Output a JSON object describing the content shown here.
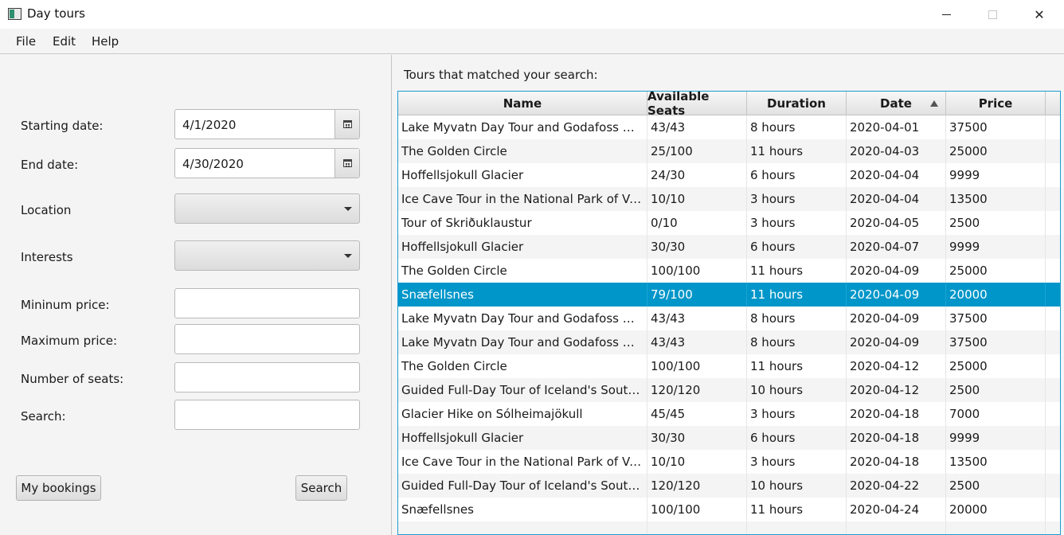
{
  "window": {
    "title": "Day tours",
    "minimize": "",
    "maximize": "",
    "close": "✕"
  },
  "menu": [
    "File",
    "Edit",
    "Help"
  ],
  "form": {
    "starting_date_label": "Starting date:",
    "starting_date_value": "4/1/2020",
    "end_date_label": "End date:",
    "end_date_value": "4/30/2020",
    "location_label": "Location",
    "location_value": "",
    "interests_label": "Interests",
    "interests_value": "",
    "min_price_label": "Mininum price:",
    "min_price_value": "",
    "max_price_label": "Maximum price:",
    "max_price_value": "",
    "seats_label": "Number of seats:",
    "seats_value": "",
    "search_label": "Search:",
    "search_value": "",
    "my_bookings_button": "My bookings",
    "search_button": "Search"
  },
  "results": {
    "label": "Tours that matched your search:",
    "columns": [
      "Name",
      "Available Seats",
      "Duration",
      "Date",
      "Price"
    ],
    "sorted_column": "Date",
    "sort_direction": "ascending",
    "selected_row": 7,
    "rows": [
      [
        "Lake Myvatn Day Tour and Godafoss Waterf...",
        "43/43",
        "8 hours",
        "2020-04-01",
        "37500"
      ],
      [
        "The Golden Circle",
        "25/100",
        "11 hours",
        "2020-04-03",
        "25000"
      ],
      [
        "Hoffellsjokull Glacier",
        "24/30",
        "6 hours",
        "2020-04-04",
        "9999"
      ],
      [
        "Ice Cave Tour in the National Park of Vatnaj...",
        "10/10",
        "3 hours",
        "2020-04-04",
        "13500"
      ],
      [
        "Tour of Skriðuklaustur",
        "0/10",
        "3 hours",
        "2020-04-05",
        "2500"
      ],
      [
        "Hoffellsjokull Glacier",
        "30/30",
        "6 hours",
        "2020-04-07",
        "9999"
      ],
      [
        "The Golden Circle",
        "100/100",
        "11 hours",
        "2020-04-09",
        "25000"
      ],
      [
        "Snæfellsnes",
        "79/100",
        "11 hours",
        "2020-04-09",
        "20000"
      ],
      [
        "Lake Myvatn Day Tour and Godafoss Waterf...",
        "43/43",
        "8 hours",
        "2020-04-09",
        "37500"
      ],
      [
        "Lake Myvatn Day Tour and Godafoss Waterf...",
        "43/43",
        "8 hours",
        "2020-04-09",
        "37500"
      ],
      [
        "The Golden Circle",
        "100/100",
        "11 hours",
        "2020-04-12",
        "25000"
      ],
      [
        "Guided Full-Day Tour of Iceland's South Coast",
        "120/120",
        "10 hours",
        "2020-04-12",
        "2500"
      ],
      [
        "Glacier Hike on Sólheimajökull",
        "45/45",
        "3 hours",
        "2020-04-18",
        "7000"
      ],
      [
        "Hoffellsjokull Glacier",
        "30/30",
        "6 hours",
        "2020-04-18",
        "9999"
      ],
      [
        "Ice Cave Tour in the National Park of Vatnaj...",
        "10/10",
        "3 hours",
        "2020-04-18",
        "13500"
      ],
      [
        "Guided Full-Day Tour of Iceland's South Coast",
        "120/120",
        "10 hours",
        "2020-04-22",
        "2500"
      ],
      [
        "Snæfellsnes",
        "100/100",
        "11 hours",
        "2020-04-24",
        "20000"
      ],
      [
        "",
        "",
        "",
        "",
        ""
      ]
    ]
  }
}
